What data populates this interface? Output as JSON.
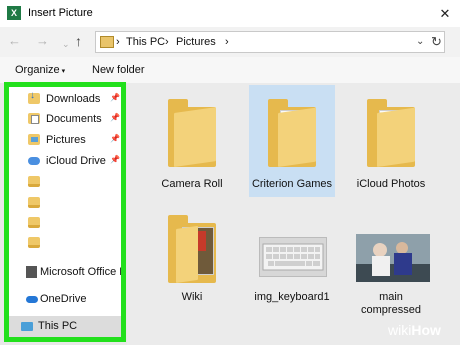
{
  "window": {
    "title": "Insert Picture",
    "close_glyph": "✕"
  },
  "nav": {
    "back_glyph": "←",
    "forward_glyph": "→",
    "recent_glyph": "⌄",
    "up_glyph": "↑",
    "breadcrumb": [
      "This PC",
      "Pictures"
    ],
    "separator_glyph": "›",
    "dropdown_glyph": "⌄",
    "refresh_glyph": "↻"
  },
  "toolbar": {
    "organize_label": "Organize",
    "organize_chevron": "▾",
    "new_folder_label": "New folder"
  },
  "sidebar": {
    "pin_glyph": "📌",
    "items": [
      {
        "label": "Downloads",
        "icon": "downloads-icon",
        "pinned": true
      },
      {
        "label": "Documents",
        "icon": "documents-icon",
        "pinned": true
      },
      {
        "label": "Pictures",
        "icon": "pictures-icon",
        "pinned": true
      },
      {
        "label": "iCloud Drive",
        "icon": "cloud-icon",
        "pinned": true
      },
      {
        "label": "",
        "icon": "folder-icon"
      },
      {
        "label": "",
        "icon": "folder-icon"
      },
      {
        "label": "",
        "icon": "folder-icon"
      },
      {
        "label": "",
        "icon": "folder-icon"
      },
      {
        "label": "Microsoft Office E",
        "icon": "office-icon"
      },
      {
        "label": "OneDrive",
        "icon": "onedrive-icon"
      },
      {
        "label": "This PC",
        "icon": "computer-icon",
        "selected": true
      }
    ],
    "highlight_color": "#22e01c"
  },
  "files": [
    {
      "name": "Camera Roll",
      "type": "folder"
    },
    {
      "name": "Criterion Games",
      "type": "folder",
      "selected": true
    },
    {
      "name": "iCloud Photos",
      "type": "folder"
    },
    {
      "name": "Wiki",
      "type": "folder"
    },
    {
      "name": "img_keyboard1",
      "type": "image"
    },
    {
      "name": "main\ncompressed",
      "line1": "main",
      "line2": "compressed",
      "type": "image"
    }
  ],
  "watermark": {
    "prefix": "wiki",
    "suffix": "How"
  }
}
